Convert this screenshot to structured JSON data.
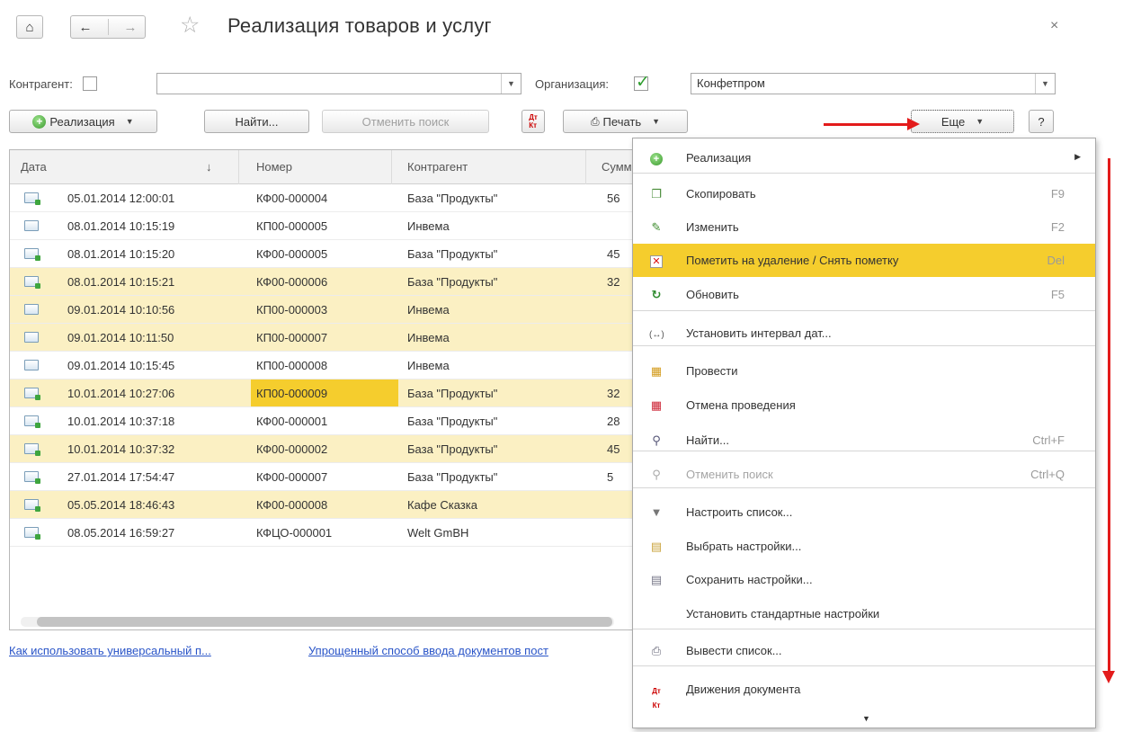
{
  "window": {
    "title": "Реализация товаров и услуг",
    "home_icon": "home-icon",
    "back_icon": "arrow-left-icon",
    "forward_icon": "arrow-right-icon",
    "star_icon": "star-icon",
    "close_icon": "close-icon",
    "close_glyph": "×"
  },
  "filters": {
    "counterparty_label": "Контрагент:",
    "counterparty_value": "",
    "organization_label": "Организация:",
    "organization_value": "Конфетпром"
  },
  "toolbar": {
    "create_label": "Реализация",
    "find_label": "Найти...",
    "cancel_search_label": "Отменить поиск",
    "print_label": "Печать",
    "more_label": "Еще",
    "help_label": "?"
  },
  "table": {
    "columns": [
      "Дата",
      "Номер",
      "Контрагент",
      "Сумм"
    ],
    "sort_indicator": "↓",
    "rows": [
      {
        "date": "05.01.2014 12:00:01",
        "number": "КФ00-000004",
        "contractor": "База \"Продукты\"",
        "sum": "56",
        "posted": true,
        "highlight": false
      },
      {
        "date": "08.01.2014 10:15:19",
        "number": "КП00-000005",
        "contractor": "Инвема",
        "sum": "",
        "posted": false,
        "highlight": false
      },
      {
        "date": "08.01.2014 10:15:20",
        "number": "КФ00-000005",
        "contractor": "База \"Продукты\"",
        "sum": "45",
        "posted": true,
        "highlight": false
      },
      {
        "date": "08.01.2014 10:15:21",
        "number": "КФ00-000006",
        "contractor": "База \"Продукты\"",
        "sum": "32",
        "posted": true,
        "highlight": true
      },
      {
        "date": "09.01.2014 10:10:56",
        "number": "КП00-000003",
        "contractor": "Инвема",
        "sum": "",
        "posted": false,
        "highlight": true
      },
      {
        "date": "09.01.2014 10:11:50",
        "number": "КП00-000007",
        "contractor": "Инвема",
        "sum": "",
        "posted": false,
        "highlight": true
      },
      {
        "date": "09.01.2014 10:15:45",
        "number": "КП00-000008",
        "contractor": "Инвема",
        "sum": "",
        "posted": false,
        "highlight": false
      },
      {
        "date": "10.01.2014 10:27:06",
        "number": "КП00-000009",
        "contractor": "База \"Продукты\"",
        "sum": "32",
        "posted": true,
        "highlight": true,
        "selected_cell": true
      },
      {
        "date": "10.01.2014 10:37:18",
        "number": "КФ00-000001",
        "contractor": "База \"Продукты\"",
        "sum": "28",
        "posted": true,
        "highlight": false
      },
      {
        "date": "10.01.2014 10:37:32",
        "number": "КФ00-000002",
        "contractor": "База \"Продукты\"",
        "sum": "45",
        "posted": true,
        "highlight": true
      },
      {
        "date": "27.01.2014 17:54:47",
        "number": "КФ00-000007",
        "contractor": "База \"Продукты\"",
        "sum": "5",
        "posted": true,
        "highlight": false
      },
      {
        "date": "05.05.2014 18:46:43",
        "number": "КФ00-000008",
        "contractor": "Кафе Сказка",
        "sum": "",
        "posted": true,
        "highlight": true
      },
      {
        "date": "08.05.2014 16:59:27",
        "number": "КФЦО-000001",
        "contractor": "Welt GmBH",
        "sum": "",
        "posted": true,
        "highlight": false
      }
    ]
  },
  "links": [
    "Как использовать универсальный п...",
    "Упрощенный способ ввода документов пост"
  ],
  "menu": {
    "items": [
      {
        "label": "Реализация",
        "shortcut": "",
        "icon": "green-plus-icon",
        "submenu": true
      },
      {
        "label": "Скопировать",
        "shortcut": "F9",
        "icon": "copy-icon"
      },
      {
        "label": "Изменить",
        "shortcut": "F2",
        "icon": "pencil-icon"
      },
      {
        "label": "Пометить на удаление / Снять пометку",
        "shortcut": "Del",
        "icon": "delete-mark-icon",
        "active": true
      },
      {
        "label": "Обновить",
        "shortcut": "F5",
        "icon": "refresh-icon"
      },
      {
        "label": "Установить интервал дат...",
        "shortcut": "",
        "icon": "date-interval-icon"
      },
      {
        "label": "Провести",
        "shortcut": "",
        "icon": "post-icon"
      },
      {
        "label": "Отмена проведения",
        "shortcut": "",
        "icon": "unpost-icon"
      },
      {
        "label": "Найти...",
        "shortcut": "Ctrl+F",
        "icon": "search-icon"
      },
      {
        "label": "Отменить поиск",
        "shortcut": "Ctrl+Q",
        "icon": "cancel-search-icon",
        "disabled": true
      },
      {
        "label": "Настроить список...",
        "shortcut": "",
        "icon": "filter-icon"
      },
      {
        "label": "Выбрать настройки...",
        "shortcut": "",
        "icon": "open-settings-icon"
      },
      {
        "label": "Сохранить настройки...",
        "shortcut": "",
        "icon": "save-settings-icon"
      },
      {
        "label": "Установить стандартные настройки",
        "shortcut": "",
        "icon": ""
      },
      {
        "label": "Вывести список...",
        "shortcut": "",
        "icon": "print-list-icon"
      },
      {
        "label": "Движения документа",
        "shortcut": "",
        "icon": "dt-kt-icon"
      }
    ]
  },
  "colors": {
    "highlight_row": "#fbf0c3",
    "selection": "#f5cd2d",
    "arrow": "#e31b1b",
    "link": "#2a55c8"
  }
}
